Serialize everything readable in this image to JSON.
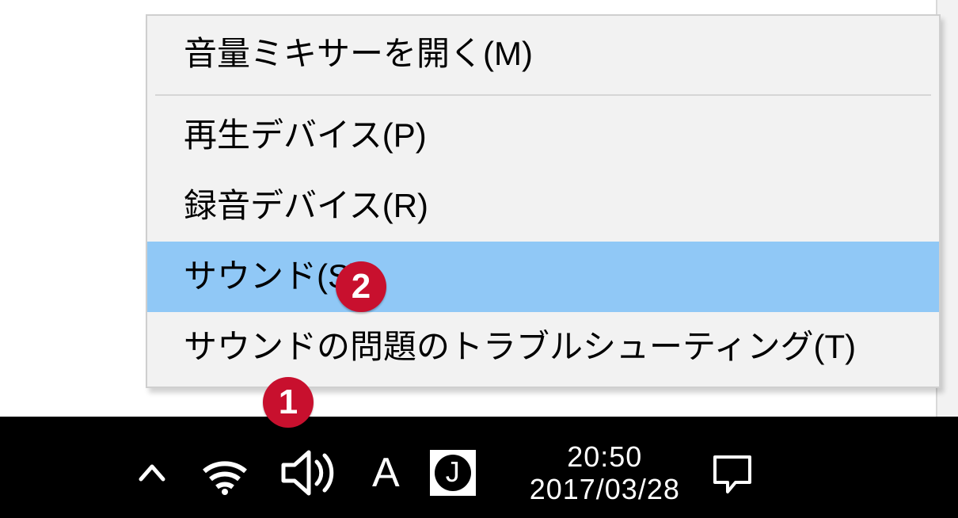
{
  "context_menu": {
    "items": [
      {
        "label": "音量ミキサーを開く(M)",
        "selected": false,
        "group": 0
      },
      {
        "label": "再生デバイス(P)",
        "selected": false,
        "group": 1
      },
      {
        "label": "録音デバイス(R)",
        "selected": false,
        "group": 1
      },
      {
        "label": "サウンド(S)",
        "selected": true,
        "group": 1
      },
      {
        "label": "サウンドの問題のトラブルシューティング(T)",
        "selected": false,
        "group": 1
      }
    ]
  },
  "tray": {
    "ime_mode": "A",
    "ime_engine": "J",
    "clock": {
      "time": "20:50",
      "date": "2017/03/28"
    }
  },
  "annotations": {
    "badge_1": "1",
    "badge_2": "2"
  },
  "colors": {
    "menu_bg": "#f2f2f2",
    "menu_highlight": "#90c8f6",
    "badge": "#c8102e",
    "taskbar": "#000000"
  }
}
